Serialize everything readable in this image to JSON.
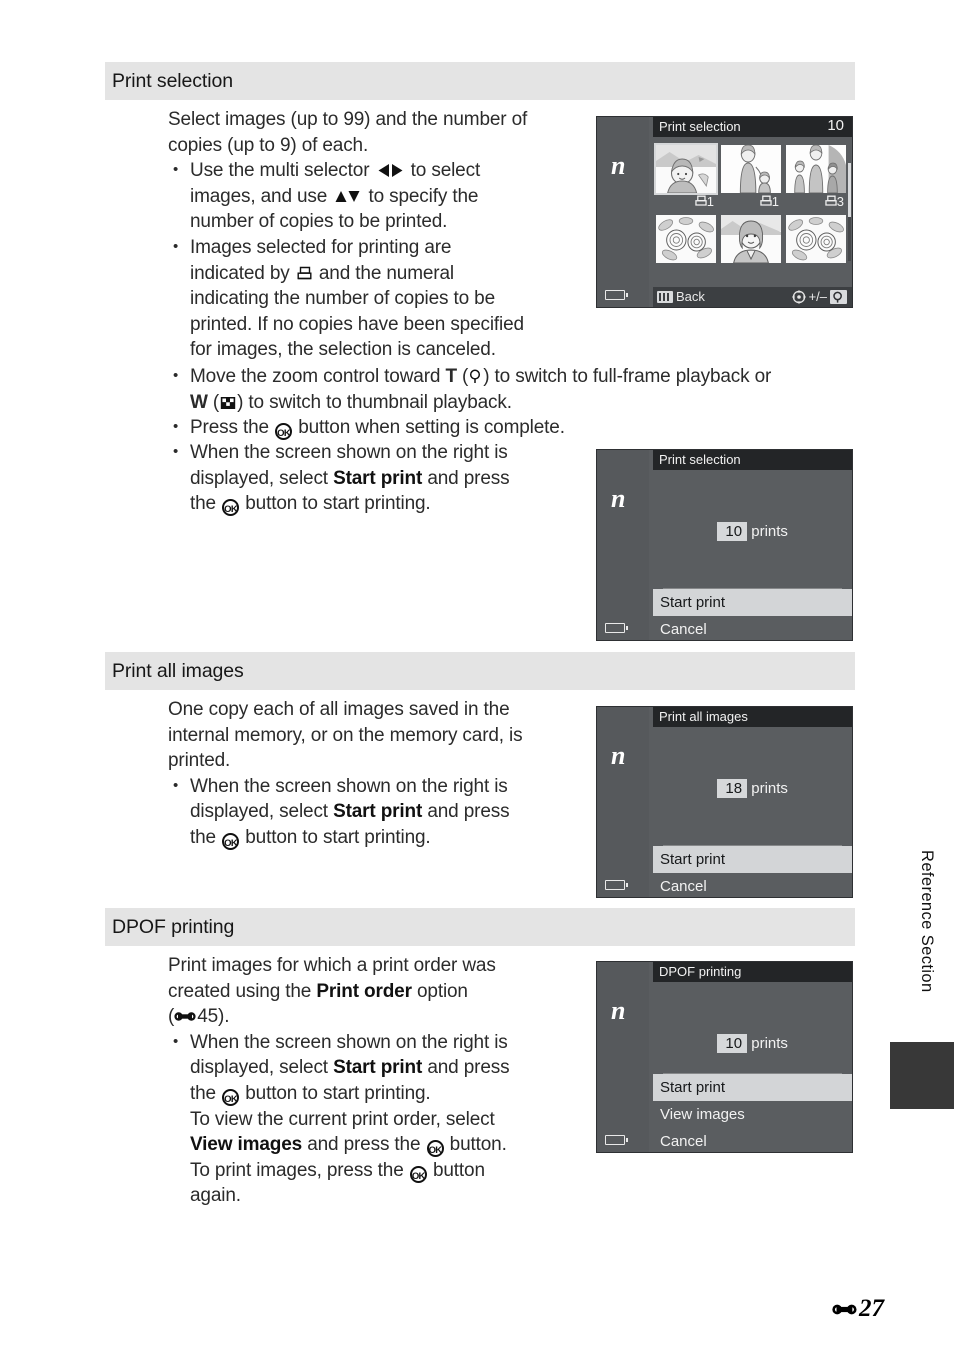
{
  "page": {
    "folio_number": "27",
    "folio_icon": "reference-mark-icon",
    "side_tab_label": "Reference Section"
  },
  "sections": [
    {
      "id": "print-selection",
      "heading": "Print selection",
      "intro": "Select images (up to 99) and the number of copies (up to 9) of each.",
      "bullets": [
        "Use the multi selector ◀▶ to select images, and use ▲▼ to specify the number of copies to be printed.",
        "Images selected for printing are indicated by ⧉ and the numeral indicating the number of copies to be printed. If no copies have been specified for images, the selection is canceled.",
        "Move the zoom control toward T (⌕) to switch to full-frame playback or W (⊞) to switch to thumbnail playback.",
        "Press the OK button when setting is complete.",
        "When the screen shown on the right is displayed, select Start print and press the OK button to start printing."
      ]
    },
    {
      "id": "print-all-images",
      "heading": "Print all images",
      "intro": "One copy each of all images saved in the internal memory, or on the memory card, is printed.",
      "bullets": [
        "When the screen shown on the right is displayed, select Start print and press the OK button to start printing."
      ]
    },
    {
      "id": "dpof-printing",
      "heading": "DPOF printing",
      "intro": "Print images for which a print order was created using the Print order option (45).",
      "bullets": [
        "When the screen shown on the right is displayed, select Start print and press the OK button to start printing. To view the current print order, select View images and press the OK button. To print images, press the OK button again."
      ]
    }
  ],
  "text": {
    "intro1_line1": "Select images (up to 99) and the number of",
    "intro1_line2": "copies (up to 9) of each.",
    "b1_a": "Use the multi selector",
    "b1_b": "to select",
    "b1_c": "images, and use",
    "b1_d": "to specify the",
    "b1_e": "number of copies to be printed.",
    "b2_a": "Images selected for printing are",
    "b2_b": "indicated by",
    "b2_c": "and the numeral",
    "b2_d": "indicating the number of copies to be",
    "b2_e": "printed. If no copies have been specified",
    "b2_f": "for images, the selection is canceled.",
    "b3_a": "Move the zoom control toward",
    "b3_T": "T",
    "b3_b": ") to switch to full-frame playback or",
    "b3_W": "W",
    "b3_c": ") to switch to thumbnail playback.",
    "b4_a": "Press the",
    "b4_b": "button when setting is complete.",
    "b5_l1": "When the screen shown on the right is",
    "b5_l2_a": "displayed, select",
    "b5_l2_bold": "Start print",
    "b5_l2_b": "and press",
    "b5_l3_a": "the",
    "b5_l3_b": "button to start printing.",
    "pa_l1": "One copy each of all images saved in the",
    "pa_l2": "internal memory, or on the memory card, is",
    "pa_l3": "printed.",
    "dp_l1": "Print images for which a print order was",
    "dp_l2_a": "created using the",
    "dp_l2_bold": "Print order",
    "dp_l2_b": "option",
    "dp_l3_a": "(",
    "dp_l3_num": "45).",
    "dp_l4": "To view the current print order, select",
    "dp_l5_bold": "View images",
    "dp_l5_a": "and press the",
    "dp_l5_b": "button.",
    "dp_l6_a": "To print images, press the",
    "dp_l6_b": "button",
    "dp_l7": "again."
  },
  "screens": {
    "print_selection_grid": {
      "title": "Print selection",
      "count": "10",
      "back_label": "Back",
      "back_icon": "menu-icon",
      "adjust_label": "+/–",
      "zoom_icon": "magnifier-icon",
      "multiselector_icon": "multi-selector-icon",
      "thumbnails": [
        {
          "copies": "1",
          "selected": true,
          "scene": "girl-outdoors"
        },
        {
          "copies": "1",
          "selected": false,
          "scene": "woman-and-child"
        },
        {
          "copies": "3",
          "selected": false,
          "scene": "family-walking"
        },
        {
          "copies": "",
          "selected": false,
          "scene": "flowers"
        },
        {
          "copies": "",
          "selected": false,
          "scene": "portrait-woman"
        },
        {
          "copies": "",
          "selected": false,
          "scene": "flowers"
        }
      ]
    },
    "print_selection_dialog": {
      "title": "Print selection",
      "count_value": "10",
      "count_unit": "prints",
      "options": [
        {
          "label": "Start print",
          "highlighted": true
        },
        {
          "label": "Cancel",
          "highlighted": false
        }
      ]
    },
    "print_all_dialog": {
      "title": "Print all images",
      "count_value": "18",
      "count_unit": "prints",
      "options": [
        {
          "label": "Start print",
          "highlighted": true
        },
        {
          "label": "Cancel",
          "highlighted": false
        }
      ]
    },
    "dpof_dialog": {
      "title": "DPOF printing",
      "count_value": "10",
      "count_unit": "prints",
      "options": [
        {
          "label": "Start print",
          "highlighted": true
        },
        {
          "label": "View images",
          "highlighted": false
        },
        {
          "label": "Cancel",
          "highlighted": false
        }
      ]
    }
  },
  "colors": {
    "section_header_bg": "#e4e4e4",
    "camera_body": "#5a5d60",
    "camera_titlebar": "#232527",
    "camera_highlight": "#d3d5d7",
    "side_tab_block": "#383838"
  }
}
